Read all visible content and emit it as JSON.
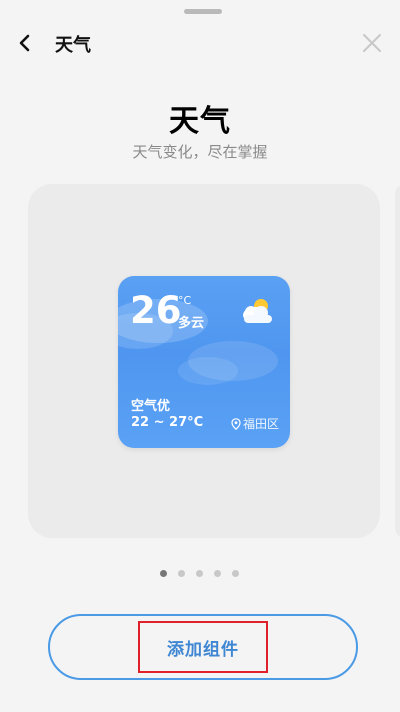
{
  "header": {
    "title": "天气"
  },
  "hero": {
    "title": "天气",
    "subtitle": "天气变化，尽在掌握"
  },
  "widget": {
    "temperature": "26",
    "unit": "°C",
    "condition": "多云",
    "air_quality": "空气优",
    "temp_range": "22 ~ 27°C",
    "location": "福田区",
    "icon": "partly-cloudy-icon",
    "gradient_top": "#5aa0f3",
    "gradient_bottom": "#5aa2f5"
  },
  "pager": {
    "count": 5,
    "active_index": 0
  },
  "actions": {
    "add_label": "添加组件",
    "accent": "#4a9ae6",
    "highlight": "#e0202a"
  }
}
